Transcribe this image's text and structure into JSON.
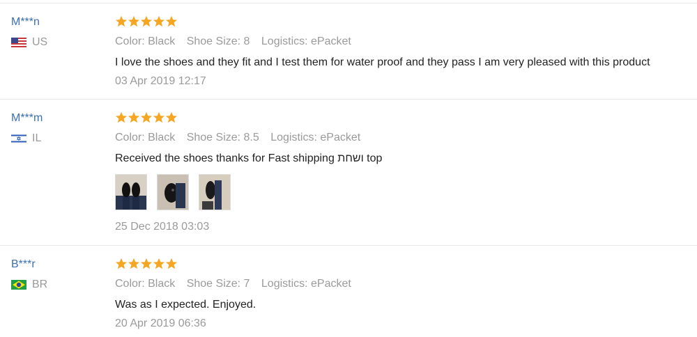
{
  "reviews": [
    {
      "user": "M***n",
      "country": "US",
      "flag": "us-flag-icon",
      "rating": 5,
      "attrs": {
        "color": "Color: Black",
        "size": "Shoe Size: 8",
        "logistics": "Logistics: ePacket"
      },
      "text": "I love the shoes and they fit and I test them for water proof and they pass I am very pleased with this product",
      "date": "03 Apr 2019 12:17"
    },
    {
      "user": "M***m",
      "country": "IL",
      "flag": "il-flag-icon",
      "rating": 5,
      "attrs": {
        "color": "Color: Black",
        "size": "Shoe Size: 8.5",
        "logistics": "Logistics: ePacket"
      },
      "text": "Received the shoes thanks for Fast shipping ושחת top",
      "photos": [
        "review-photo-1",
        "review-photo-2",
        "review-photo-3"
      ],
      "date": "25 Dec 2018 03:03"
    },
    {
      "user": "B***r",
      "country": "BR",
      "flag": "br-flag-icon",
      "rating": 5,
      "attrs": {
        "color": "Color: Black",
        "size": "Shoe Size: 7",
        "logistics": "Logistics: ePacket"
      },
      "text": "Was as I expected. Enjoyed.",
      "date": "20 Apr 2019 06:36"
    }
  ],
  "colors": {
    "star": "#f5a623",
    "username": "#3a6fb0",
    "meta": "#9a9a9a"
  }
}
